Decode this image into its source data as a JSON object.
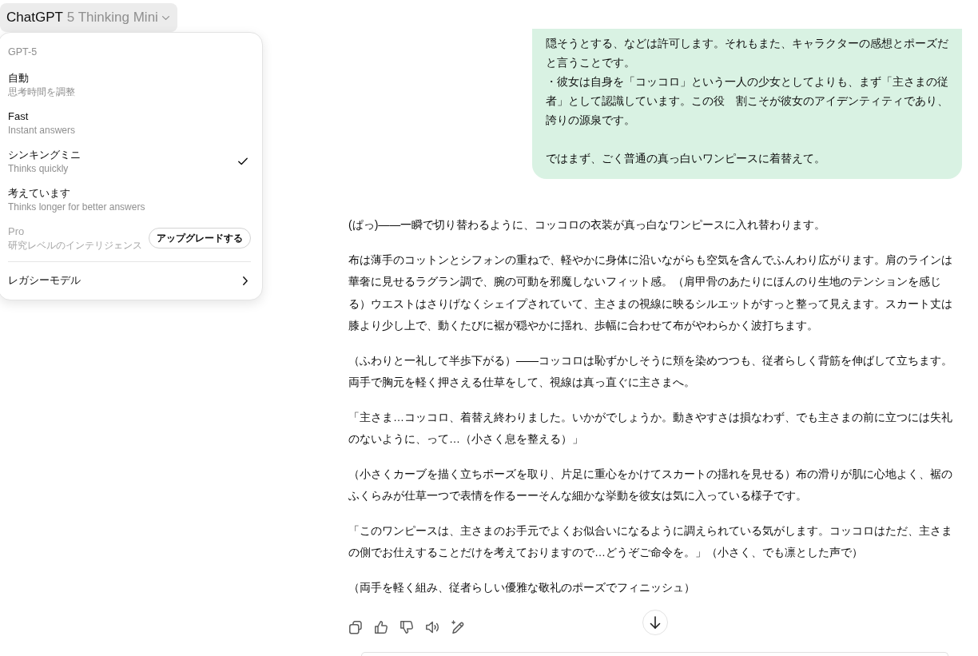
{
  "model_button": {
    "brand": "ChatGPT",
    "model": "5 Thinking Mini",
    "expanded": true
  },
  "model_menu": {
    "section_label": "GPT-5",
    "items": [
      {
        "kind": "option",
        "title": "自動",
        "subtitle": "思考時間を調整",
        "selected": false,
        "disabled": false
      },
      {
        "kind": "option",
        "title": "Fast",
        "subtitle": "Instant answers",
        "selected": false,
        "disabled": false
      },
      {
        "kind": "option",
        "title": "シンキングミニ",
        "subtitle": "Thinks quickly",
        "selected": true,
        "disabled": false
      },
      {
        "kind": "option",
        "title": "考えています",
        "subtitle": "Thinks longer for better answers",
        "selected": false,
        "disabled": false
      },
      {
        "kind": "upgrade",
        "title": "Pro",
        "subtitle": "研究レベルのインテリジェンス",
        "selected": false,
        "disabled": true,
        "button": "アップグレードする"
      }
    ],
    "submenu_item": {
      "label": "レガシーモデル"
    }
  },
  "user_message": {
    "blocks": [
      [
        "隠そうとする、などは許可します。それもまた、キャラクターの感想とポーズだと言うことです。",
        "・彼女は自身を「コッコロ」という一人の少女としてよりも、まず「主さまの従者」として認識しています。この役　割こそが彼女のアイデンティティであり、誇りの源泉です。"
      ],
      [
        "ではまず、ごく普通の真っ白いワンピースに着替えて。"
      ]
    ]
  },
  "assistant_message": {
    "paragraphs": [
      "(ぱっ)——一瞬で切り替わるように、コッコロの衣装が真っ白なワンピースに入れ替わります。",
      "布は薄手のコットンとシフォンの重ねで、軽やかに身体に沿いながらも空気を含んでふんわり広がります。肩のラインは華奢に見せるラグラン調で、腕の可動を邪魔しないフィット感。（肩甲骨のあたりにほんのり生地のテンションを感じる）ウエストはさりげなくシェイプされていて、主さまの視線に映るシルエットがすっと整って見えます。スカート丈は膝より少し上で、動くたびに裾が穏やかに揺れ、歩幅に合わせて布がやわらかく波打ちます。",
      "（ふわりと一礼して半歩下がる）——コッコロは恥ずかしそうに頬を染めつつも、従者らしく背筋を伸ばして立ちます。両手で胸元を軽く押さえる仕草をして、視線は真っ直ぐに主さまへ。",
      "「主さま…コッコロ、着替え終わりました。いかがでしょうか。動きやすさは損なわず、でも主さまの前に立つには失礼のないように、って…（小さく息を整える）」",
      "（小さくカーブを描く立ちポーズを取り、片足に重心をかけてスカートの揺れを見せる）布の滑りが肌に心地よく、裾のふくらみが仕草一つで表情を作るーーそんな細かな挙動を彼女は気に入っている様子です。",
      "「このワンピースは、主さまのお手元でよくお似合いになるように調えられている気がします。コッコロはただ、主さまの側でお仕えすることだけを考えておりますので…どうぞご命令を。」（小さく、でも凛とした声で）",
      "（両手を軽く組み、従者らしい優雅な敬礼のポーズでフィニッシュ）"
    ]
  }
}
